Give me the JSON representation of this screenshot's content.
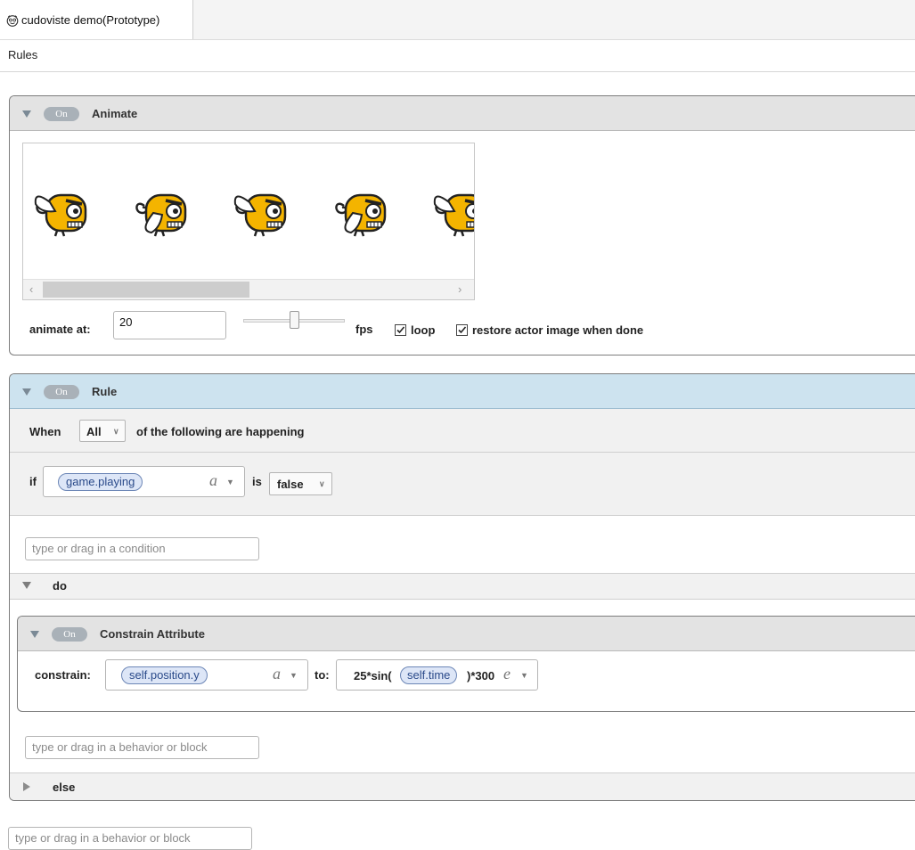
{
  "tab": {
    "icon": "bird-face-icon",
    "title": "cudoviste demo(Prototype)"
  },
  "section": {
    "label": "Rules"
  },
  "animate_block": {
    "toggle": "On",
    "title": "Animate",
    "frames": [
      "bird-frame-1",
      "bird-frame-2",
      "bird-frame-3",
      "bird-frame-4",
      "bird-frame-5"
    ],
    "animate_at_label": "animate at:",
    "fps_value": "20",
    "fps_label": "fps",
    "fps_slider_level": 0.5,
    "loop_label": "loop",
    "loop_checked": true,
    "restore_label": "restore actor image when done",
    "restore_checked": true
  },
  "rule_block": {
    "toggle": "On",
    "title": "Rule",
    "when_label": "When",
    "when_select": "All",
    "when_suffix": "of the following are happening",
    "condition": {
      "if_label": "if",
      "attribute": "game.playing",
      "type_glyph": "a",
      "is_label": "is",
      "value_select": "false"
    },
    "condition_placeholder": "type or drag in a condition",
    "do_label": "do",
    "constrain_block": {
      "toggle": "On",
      "title": "Constrain Attribute",
      "constrain_label": "constrain:",
      "attribute": "self.position.y",
      "type_glyph": "a",
      "to_label": "to:",
      "expr_prefix": "25*sin(",
      "expr_attr": "self.time",
      "expr_suffix": ")*300",
      "expr_glyph": "e"
    },
    "behavior_placeholder": "type or drag in a behavior or block",
    "else_label": "else"
  },
  "bottom_placeholder": "type or drag in a behavior or block",
  "colors": {
    "rule_header": "#cde3ef",
    "tag_fill": "#dde6f7",
    "bird_yellow": "#f4b400"
  }
}
